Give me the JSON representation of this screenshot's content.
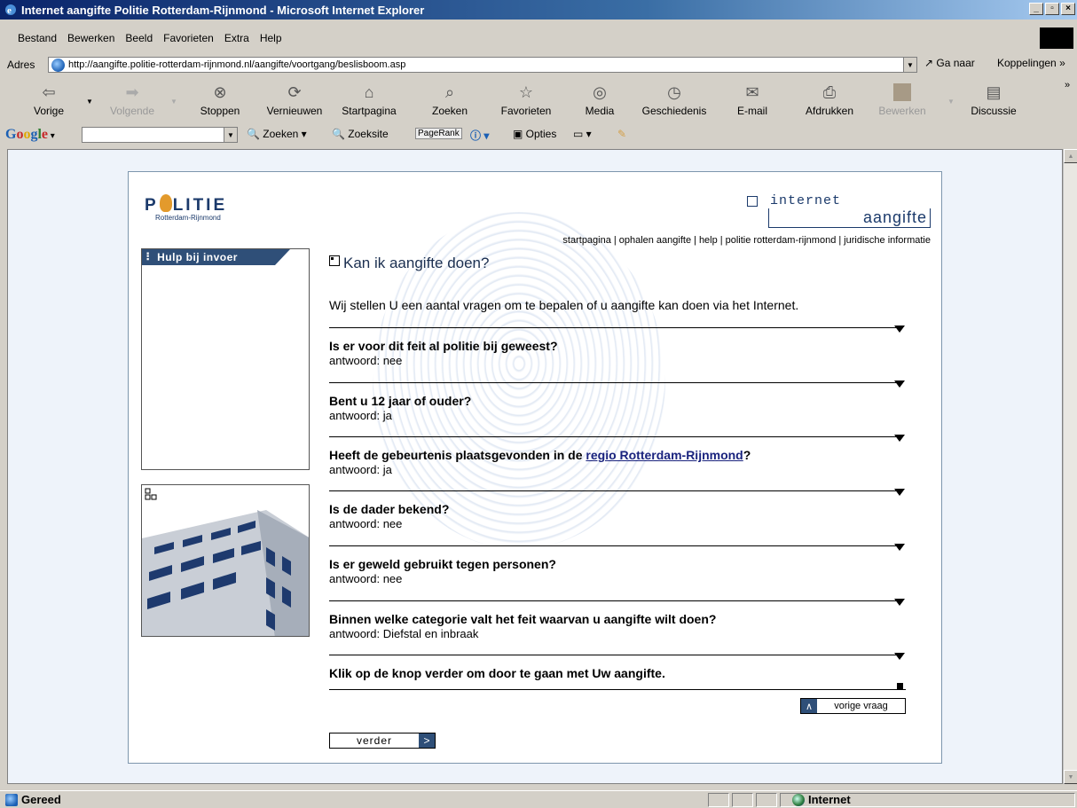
{
  "window": {
    "title": "Internet aangifte Politie Rotterdam-Rijnmond - Microsoft Internet Explorer",
    "controls": [
      "_",
      "▫",
      "×"
    ]
  },
  "menu": [
    "Bestand",
    "Bewerken",
    "Beeld",
    "Favorieten",
    "Extra",
    "Help"
  ],
  "address": {
    "label": "Adres",
    "url": "http://aangifte.politie-rotterdam-rijnmond.nl/aangifte/voortgang/beslisboom.asp",
    "go_label": "Ga naar",
    "links_label": "Koppelingen"
  },
  "toolbar": {
    "back": "Vorige",
    "forward": "Volgende",
    "stop": "Stoppen",
    "refresh": "Vernieuwen",
    "home": "Startpagina",
    "search": "Zoeken",
    "favorites": "Favorieten",
    "media": "Media",
    "history": "Geschiedenis",
    "mail": "E-mail",
    "print": "Afdrukken",
    "edit": "Bewerken",
    "discuss": "Discussie"
  },
  "googlebar": {
    "logo": "Google",
    "search": "Zoeken",
    "search_site": "Zoeksite",
    "pagerank": "PageRank",
    "options": "Opties"
  },
  "page": {
    "logo_word_1": "P",
    "logo_word_2": "LITIE",
    "logo_sub": "Rotterdam-Rijnmond",
    "ia_top": "internet",
    "ia_bottom": "aangifte",
    "nav": [
      "startpagina",
      "ophalen aangifte",
      "help",
      "politie rotterdam-rijnmond",
      "juridische informatie"
    ],
    "help_header": "Hulp bij invoer",
    "title": "Kan ik aangifte doen?",
    "intro": "Wij stellen U een aantal vragen om te bepalen of u aangifte kan doen via het Internet.",
    "questions": [
      {
        "q": "Is er voor dit feit al politie bij geweest?",
        "a": "antwoord: nee"
      },
      {
        "q": "Bent u 12 jaar of ouder?",
        "a": "antwoord: ja"
      },
      {
        "q_pre": "Heeft de gebeurtenis plaatsgevonden in de ",
        "q_link": "regio Rotterdam-Rijnmond",
        "q_post": "?",
        "a": "antwoord: ja"
      },
      {
        "q": "Is de dader bekend?",
        "a": "antwoord: nee"
      },
      {
        "q": "Is er geweld gebruikt tegen personen?",
        "a": "antwoord: nee"
      },
      {
        "q": "Binnen welke categorie valt het feit waarvan u aangifte wilt doen?",
        "a": "antwoord: Diefstal en inbraak"
      },
      {
        "q": "Klik op de knop verder om door te gaan met Uw aangifte.",
        "a": ""
      }
    ],
    "prev_label": "vorige vraag",
    "next_label": "verder"
  },
  "status": {
    "text": "Gereed",
    "zone": "Internet"
  }
}
